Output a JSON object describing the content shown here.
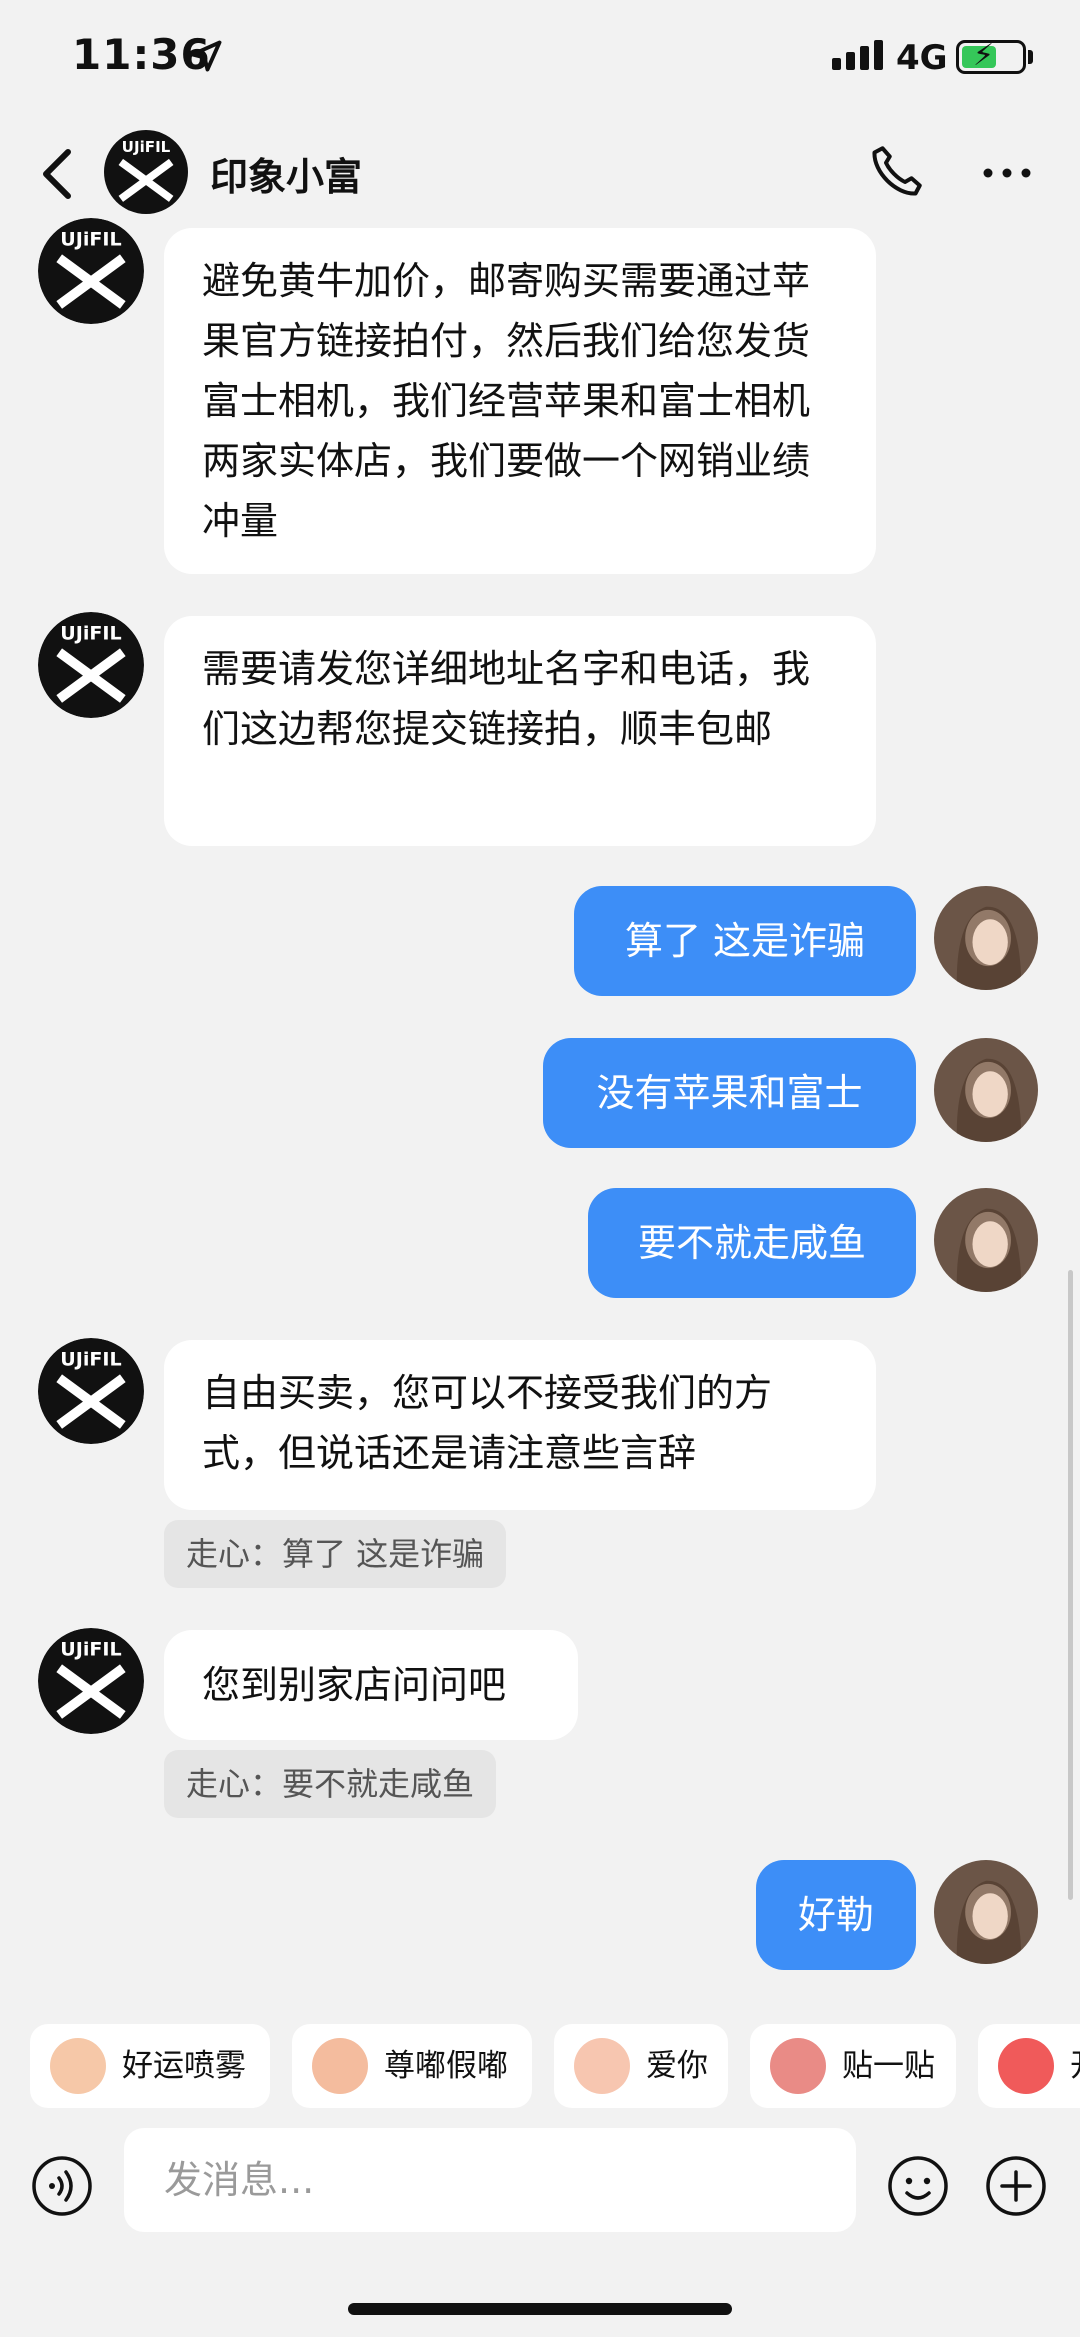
{
  "status_bar": {
    "time": "11:36",
    "network": "4G"
  },
  "header": {
    "title": "印象小富"
  },
  "messages": [
    {
      "side": "in",
      "text": "避免黄牛加价，邮寄购买需要通过苹果官方链接拍付，然后我们给您发货富士相机，我们经营苹果和富士相机两家实体店，我们要做一个网销业绩冲量"
    },
    {
      "side": "in",
      "text": "需要请发您详细地址名字和电话，我们这边帮您提交链接拍，顺丰包邮"
    },
    {
      "side": "out",
      "text": "算了 这是诈骗"
    },
    {
      "side": "out",
      "text": "没有苹果和富士"
    },
    {
      "side": "out",
      "text": "要不就走咸鱼"
    },
    {
      "side": "in",
      "text": "自由买卖，您可以不接受我们的方式，但说话还是请注意些言辞",
      "quote": "走心：算了 这是诈骗"
    },
    {
      "side": "in",
      "text": "您到别家店问问吧",
      "quote": "走心：要不就走咸鱼"
    },
    {
      "side": "out",
      "text": "好勒"
    }
  ],
  "stickers": [
    "好运喷雾",
    "尊嘟假嘟",
    "爱你",
    "贴一贴",
    "开"
  ],
  "input": {
    "placeholder": "发消息..."
  },
  "colors": {
    "out_bubble": "#3d8ef7",
    "in_bubble": "#ffffff",
    "background": "#f2f2f2"
  }
}
